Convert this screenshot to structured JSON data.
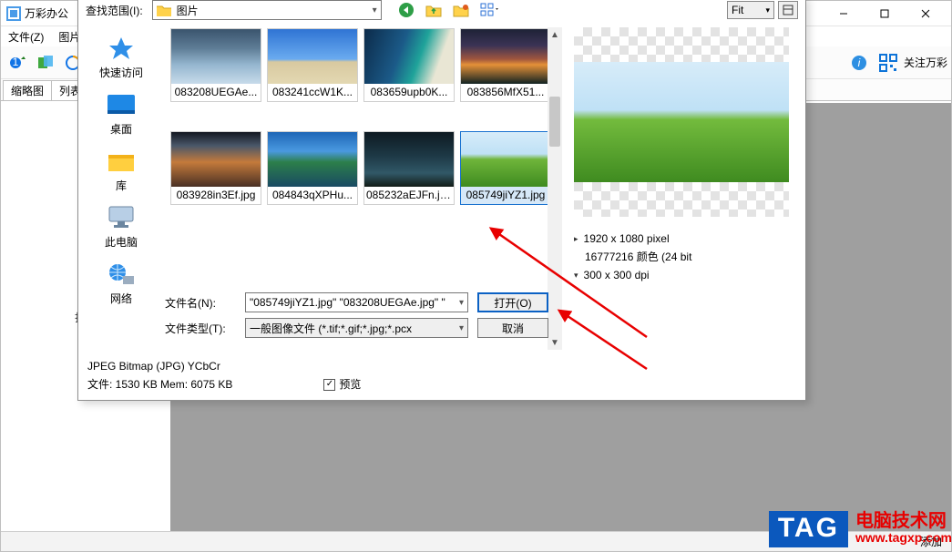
{
  "main_window": {
    "title": "万彩办公",
    "menu": {
      "file": "文件(Z)",
      "image": "图片"
    },
    "tabs": {
      "thumbnails": "缩略图",
      "list": "列表"
    },
    "attention_label": "关注万彩",
    "left_panel_label": "打开",
    "status_right": "添加"
  },
  "dialog": {
    "lookin_label": "查找范围(I):",
    "lookin_value": "图片",
    "fit_label": "Fit",
    "places": {
      "quick": "快速访问",
      "desktop": "桌面",
      "libs": "库",
      "thispc": "此电脑",
      "network": "网络"
    },
    "files": [
      {
        "name": "083208UEGAe...",
        "cls": "g-clouds"
      },
      {
        "name": "083241ccW1K...",
        "cls": "g-desert"
      },
      {
        "name": "083659upb0K...",
        "cls": "g-coast"
      },
      {
        "name": "083856MfX51...",
        "cls": "g-sunset"
      },
      {
        "name": "083928in3Ef.jpg",
        "cls": "g-mount"
      },
      {
        "name": "084843qXPHu...",
        "cls": "g-lake"
      },
      {
        "name": "085232aEJFn.jpg",
        "cls": "g-storm"
      },
      {
        "name": "085749jiYZ1.jpg",
        "cls": "g-hill"
      }
    ],
    "preview": {
      "dims": "1920 x 1080 pixel",
      "colors": "16777216 颜色 (24 bit",
      "dpi": "300 x 300 dpi"
    },
    "filename_label": "文件名(N):",
    "filename_value": "\"085749jiYZ1.jpg\" \"083208UEGAe.jpg\" \"",
    "filetype_label": "文件类型(T):",
    "filetype_value": "一般图像文件 (*.tif;*.gif;*.jpg;*.pcx",
    "open_btn": "打开(O)",
    "cancel_btn": "取消",
    "info_line1": "JPEG Bitmap (JPG) YCbCr",
    "info_line2": "文件: 1530 KB   Mem: 6075 KB",
    "preview_chk": "预览"
  },
  "watermark": {
    "tag": "TAG",
    "line1": "电脑技术网",
    "line2": "www.tagxp.com"
  }
}
